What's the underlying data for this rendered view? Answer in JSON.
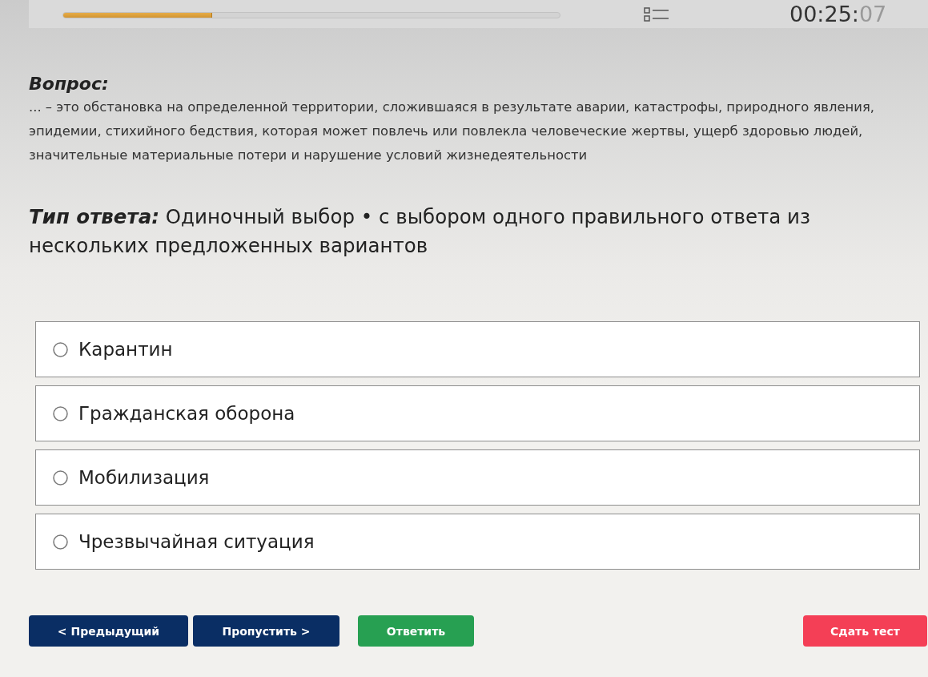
{
  "header": {
    "progress": {
      "level": 0.3
    },
    "timer": {
      "main": "00:25:",
      "seconds": "07"
    }
  },
  "question": {
    "label": "Вопрос:",
    "text": "... – это обстановка на определенной территории, сложившаяся в результате аварии, катастрофы, природного явления, эпидемии, стихийного бедствия, которая может повлечь или повлекла человеческие жертвы, ущерб здоровью людей, значительные материальные потери и нарушение условий жизнедеятельности"
  },
  "answer_type": {
    "label": "Тип ответа:",
    "value": "Одиночный выбор • с выбором одного правильного ответа из нескольких предложенных вариантов"
  },
  "options": [
    {
      "label": "Карантин",
      "selected": false
    },
    {
      "label": "Гражданская оборона",
      "selected": false
    },
    {
      "label": "Мобилизация",
      "selected": false
    },
    {
      "label": "Чрезвычайная ситуация",
      "selected": false
    }
  ],
  "buttons": [
    {
      "label": "< Предыдущий",
      "kind": "navigation"
    },
    {
      "label": "Пропустить >",
      "kind": "navigation"
    },
    {
      "label": "Ответить",
      "kind": "answer"
    },
    {
      "label": "Сдать тест",
      "kind": "finish"
    }
  ]
}
